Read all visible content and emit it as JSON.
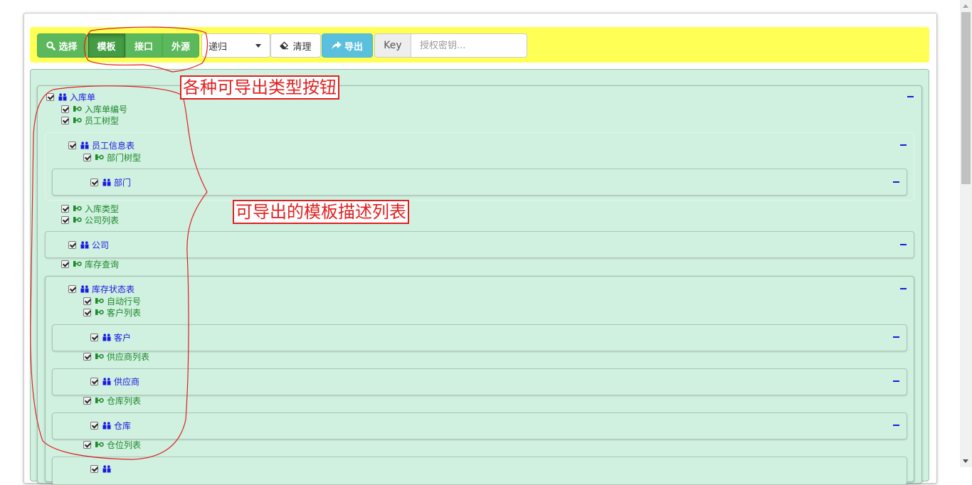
{
  "toolbar": {
    "select_label": "选择",
    "template_label": "模板",
    "interface_label": "接口",
    "external_label": "外源",
    "mode_value": "递归",
    "clear_label": "清理",
    "export_label": "导出",
    "key_label": "Key",
    "key_placeholder": "授权密钥..."
  },
  "annotations": {
    "buttons_note": "各种可导出类型按钮",
    "list_note": "可导出的模板描述列表"
  },
  "tree": {
    "inbound_order": {
      "label": "入库单",
      "fields": {
        "order_no": "入库单编号",
        "employee_tree": "员工树型",
        "inbound_type": "入库类型",
        "company_list": "公司列表",
        "stock_query": "库存查询"
      },
      "employee_info": {
        "label": "员工信息表",
        "fields": {
          "dept_tree": "部门树型"
        },
        "department": {
          "label": "部门"
        }
      },
      "company": {
        "label": "公司"
      },
      "stock_status": {
        "label": "库存状态表",
        "fields": {
          "auto_row_no": "自动行号",
          "customer_list": "客户列表",
          "supplier_list": "供应商列表",
          "warehouse_list": "仓库列表",
          "location_list": "仓位列表"
        },
        "customer": {
          "label": "客户"
        },
        "supplier": {
          "label": "供应商"
        },
        "warehouse": {
          "label": "仓库"
        }
      }
    }
  },
  "colors": {
    "toolbar_bg": "#ffff55",
    "success": "#5cb85c",
    "info": "#5bc0de",
    "panel_bg": "#d0f0e0",
    "object_text": "#1a1adf",
    "field_text": "#1d8a2a",
    "annotation": "#e02020"
  },
  "icons": {
    "select": "search-icon",
    "clear": "eraser-icon",
    "export": "share-arrow-icon",
    "object": "object-node-icon",
    "field": "field-node-icon"
  }
}
